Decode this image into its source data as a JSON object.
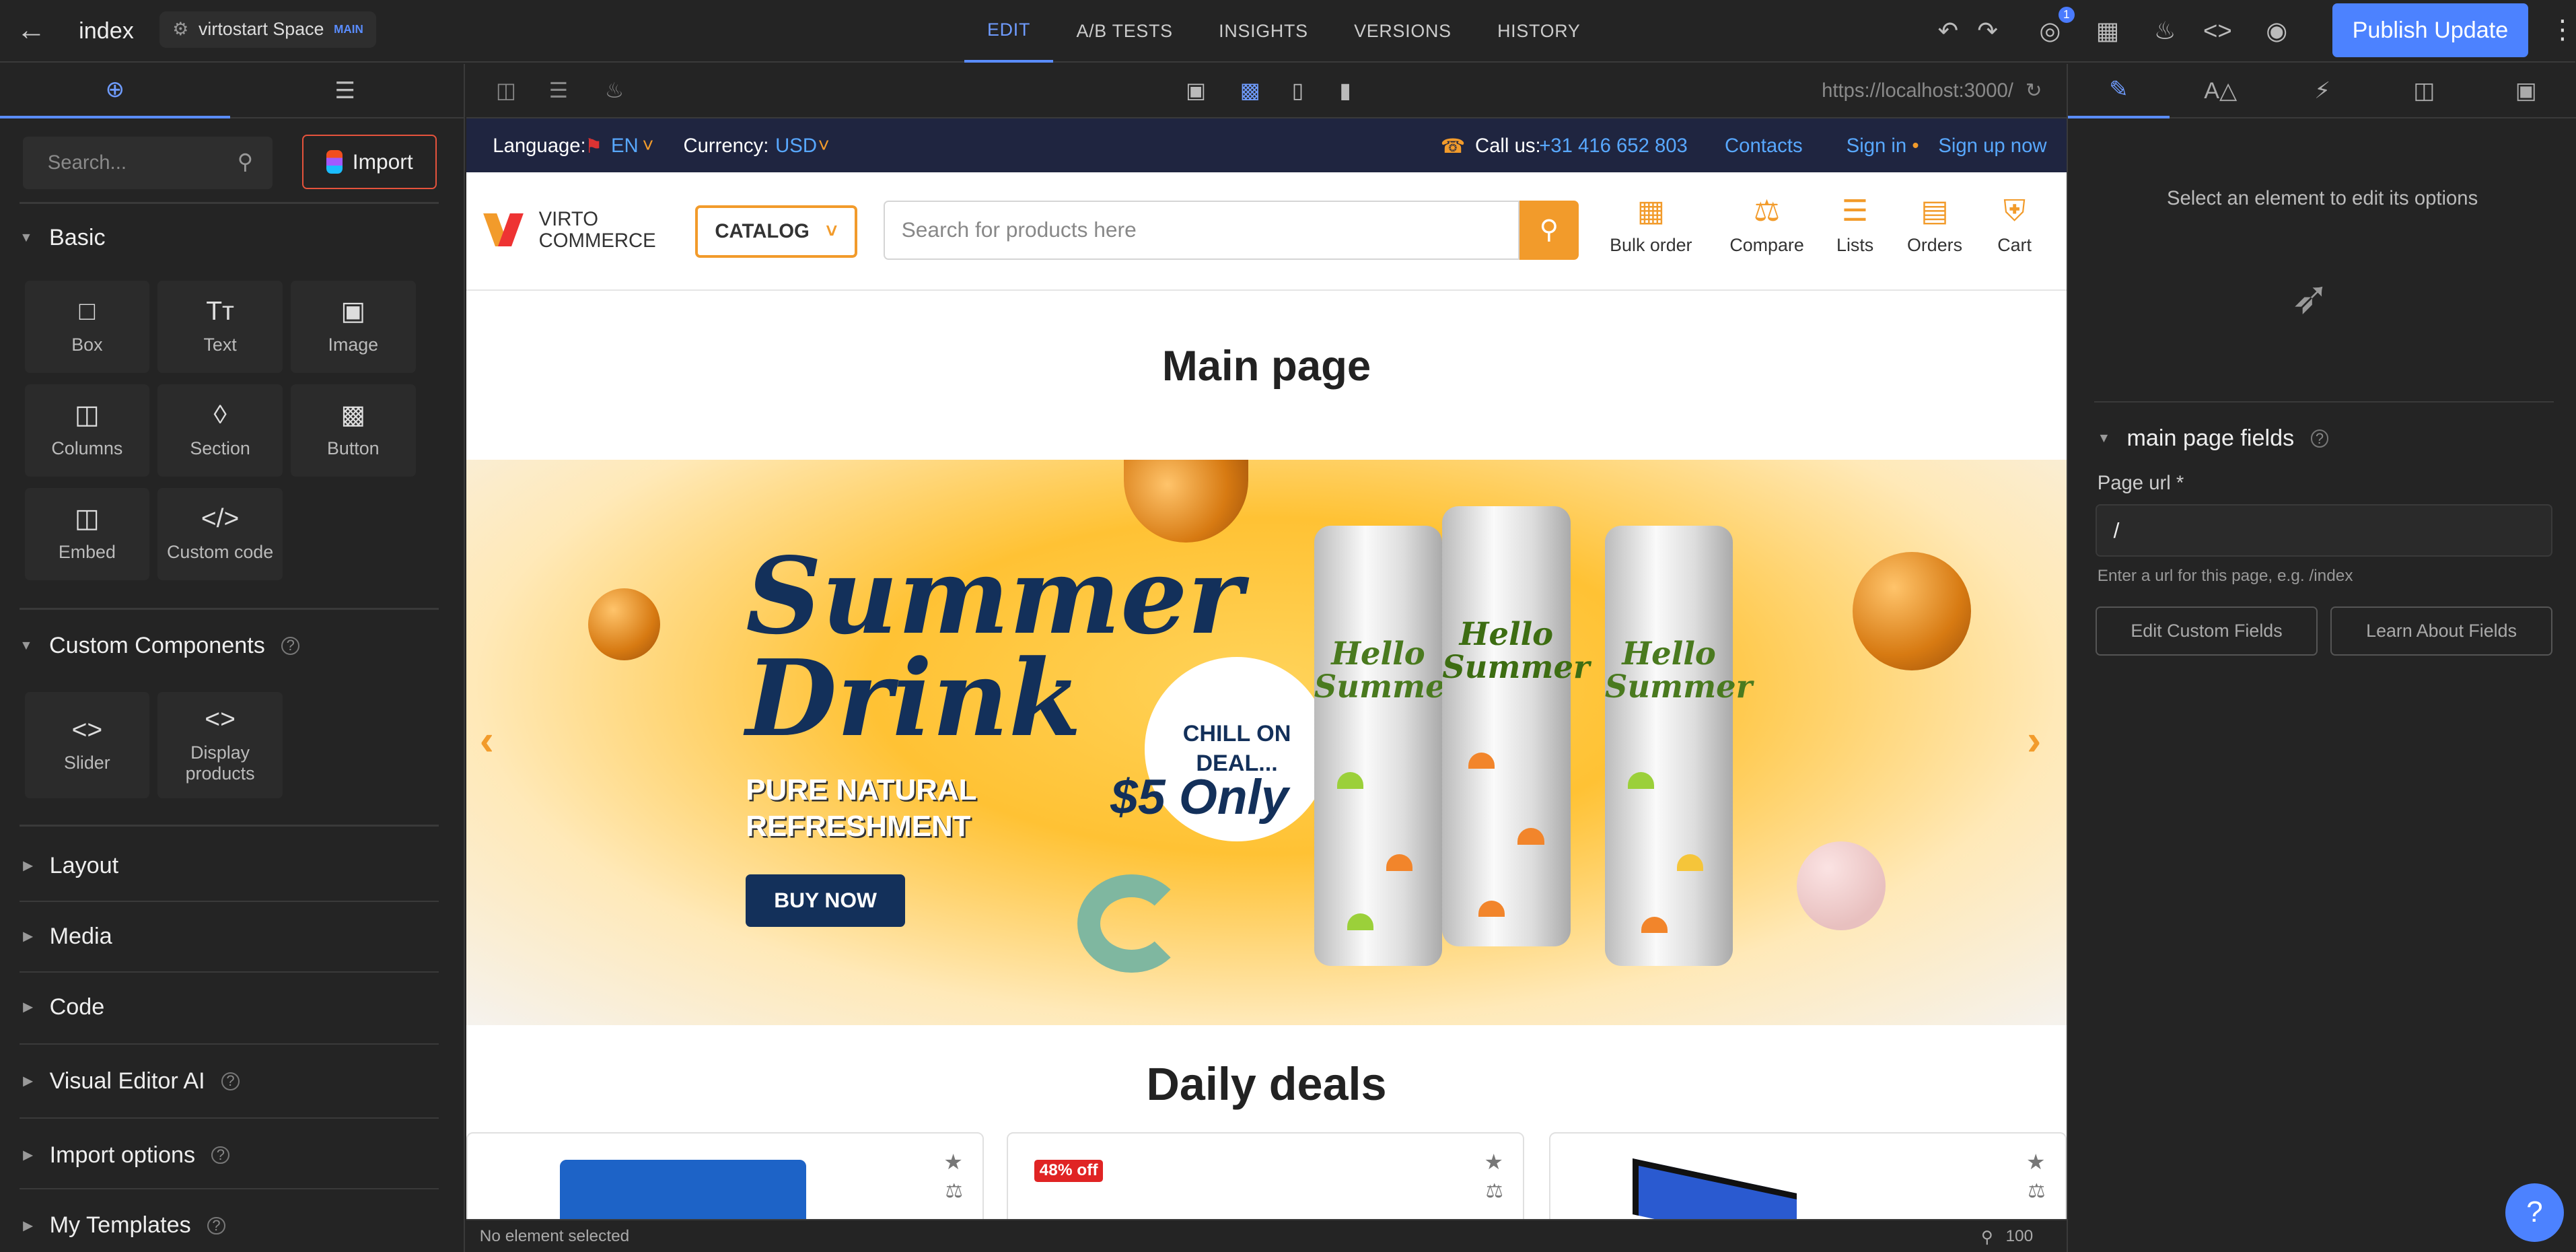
{
  "topbar": {
    "page_name": "index",
    "space_name": "virtostart Space",
    "space_tag": "MAIN",
    "tabs": [
      "EDIT",
      "A/B TESTS",
      "INSIGHTS",
      "VERSIONS",
      "HISTORY"
    ],
    "notification_count": "1",
    "publish_label": "Publish Update"
  },
  "left_panel": {
    "search_placeholder": "Search...",
    "import_label": "Import",
    "basic": {
      "title": "Basic",
      "blocks": [
        "Box",
        "Text",
        "Image",
        "Columns",
        "Section",
        "Button",
        "Embed",
        "Custom code"
      ]
    },
    "custom": {
      "title": "Custom Components",
      "blocks": [
        "Slider",
        "Display products"
      ]
    },
    "collapsed": [
      "Layout",
      "Media",
      "Code",
      "Visual Editor AI",
      "Import options",
      "My Templates"
    ]
  },
  "canvas": {
    "url": "https://localhost:3000/",
    "status": "No element selected",
    "zoom": "100"
  },
  "site": {
    "language_label": "Language:",
    "language_value": "EN",
    "currency_label": "Currency:",
    "currency_value": "USD",
    "call_label": "Call us:",
    "phone": "+31 416 652 803",
    "contacts": "Contacts",
    "sign_in": "Sign in",
    "sign_up": "Sign up now",
    "logo_line1": "VIRTO",
    "logo_line2": "COMMERCE",
    "catalog": "CATALOG",
    "search_placeholder": "Search for products here",
    "header_links": [
      "Bulk order",
      "Compare",
      "Lists",
      "Orders",
      "Cart"
    ],
    "page_title": "Main page",
    "banner": {
      "line1": "Summer",
      "line2": "Drink",
      "sub1": "PURE NATURAL",
      "sub2": "REFRESHMENT",
      "cta": "BUY NOW",
      "chill1": "CHILL ON",
      "chill2": "DEAL...",
      "price": "$5 Only",
      "can_text": "Hello Summer"
    },
    "daily_title": "Daily deals",
    "deal_badge": "48% off"
  },
  "right_panel": {
    "select_msg": "Select an element to edit its options",
    "section_title": "main page fields",
    "page_url_label": "Page url *",
    "page_url_value": "/",
    "hint": "Enter a url for this page, e.g. /index",
    "edit_btn": "Edit Custom Fields",
    "learn_btn": "Learn About Fields"
  },
  "colors": {
    "accent": "#4c82ff",
    "brand_orange": "#f29b2b",
    "site_topbar": "#1f2540",
    "banner_navy": "#13305a"
  }
}
